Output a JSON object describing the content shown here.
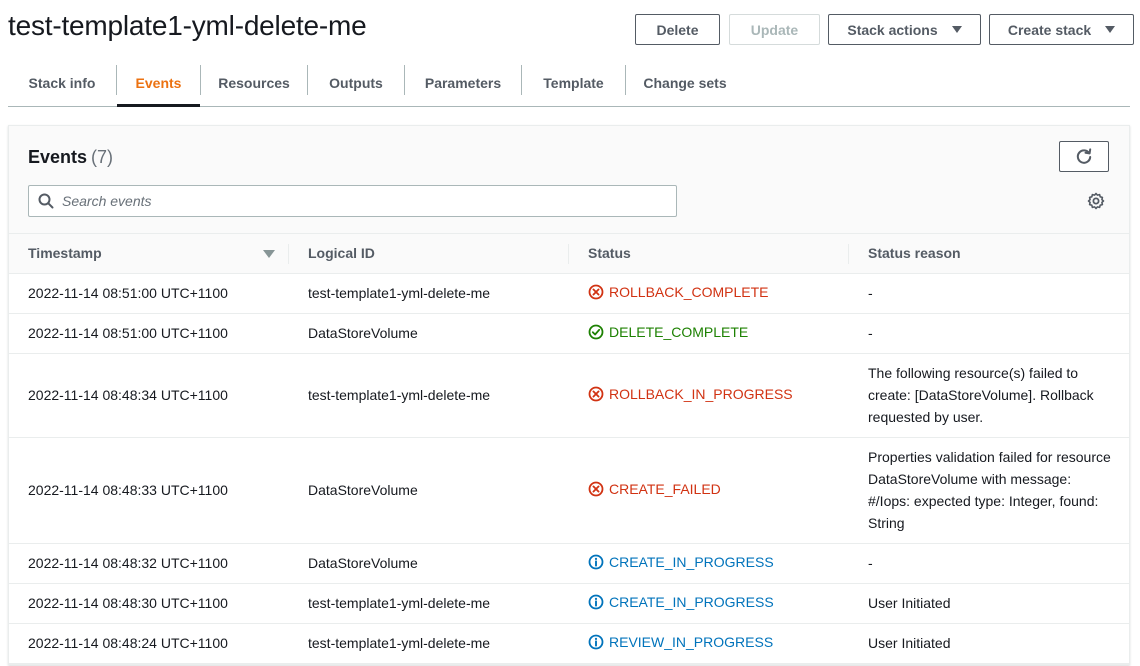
{
  "page": {
    "title": "test-template1-yml-delete-me"
  },
  "header_buttons": {
    "delete": "Delete",
    "update": "Update",
    "stack_actions": "Stack actions",
    "create_stack": "Create stack"
  },
  "tabs": [
    {
      "label": "Stack info"
    },
    {
      "label": "Events"
    },
    {
      "label": "Resources"
    },
    {
      "label": "Outputs"
    },
    {
      "label": "Parameters"
    },
    {
      "label": "Template"
    },
    {
      "label": "Change sets"
    }
  ],
  "active_tab": "Events",
  "events_panel": {
    "title": "Events",
    "count": "(7)",
    "search_placeholder": "Search events",
    "columns": {
      "timestamp": "Timestamp",
      "logical_id": "Logical ID",
      "status": "Status",
      "status_reason": "Status reason"
    },
    "rows": [
      {
        "timestamp": "2022-11-14 08:51:00 UTC+1100",
        "logical_id": "test-template1-yml-delete-me",
        "status": "ROLLBACK_COMPLETE",
        "status_icon": "error-icon",
        "status_reason": "-"
      },
      {
        "timestamp": "2022-11-14 08:51:00 UTC+1100",
        "logical_id": "DataStoreVolume",
        "status": "DELETE_COMPLETE",
        "status_icon": "success-icon",
        "status_reason": "-"
      },
      {
        "timestamp": "2022-11-14 08:48:34 UTC+1100",
        "logical_id": "test-template1-yml-delete-me",
        "status": "ROLLBACK_IN_PROGRESS",
        "status_icon": "error-icon",
        "status_reason": "The following resource(s) failed to create: [DataStoreVolume]. Rollback requested by user."
      },
      {
        "timestamp": "2022-11-14 08:48:33 UTC+1100",
        "logical_id": "DataStoreVolume",
        "status": "CREATE_FAILED",
        "status_icon": "error-icon",
        "status_reason": "Properties validation failed for resource DataStoreVolume with message: #/Iops: expected type: Integer, found: String"
      },
      {
        "timestamp": "2022-11-14 08:48:32 UTC+1100",
        "logical_id": "DataStoreVolume",
        "status": "CREATE_IN_PROGRESS",
        "status_icon": "info-icon",
        "status_reason": "-"
      },
      {
        "timestamp": "2022-11-14 08:48:30 UTC+1100",
        "logical_id": "test-template1-yml-delete-me",
        "status": "CREATE_IN_PROGRESS",
        "status_icon": "info-icon",
        "status_reason": "User Initiated"
      },
      {
        "timestamp": "2022-11-14 08:48:24 UTC+1100",
        "logical_id": "test-template1-yml-delete-me",
        "status": "REVIEW_IN_PROGRESS",
        "status_icon": "info-icon",
        "status_reason": "User Initiated"
      }
    ]
  },
  "colors": {
    "error": "#d13212",
    "success": "#1d8102",
    "info": "#0073bb",
    "active_tab": "#ec7211"
  }
}
